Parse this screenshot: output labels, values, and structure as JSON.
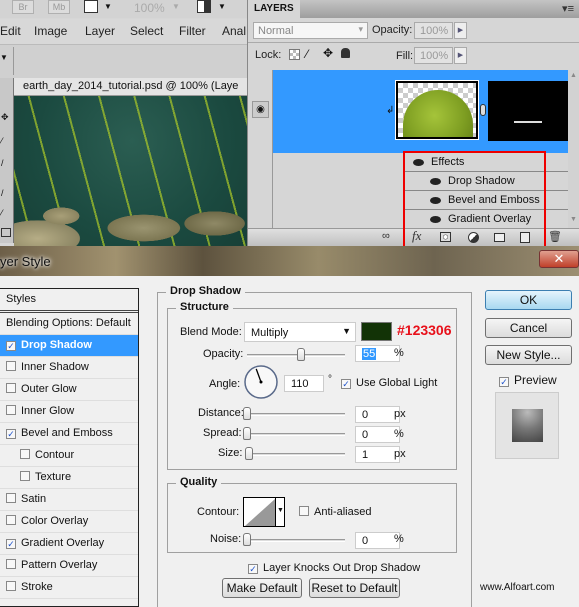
{
  "app": {
    "top_buttons": [
      "Br",
      "Mb"
    ],
    "zoom_display": "100%",
    "menu": [
      "Edit",
      "Image",
      "Layer",
      "Select",
      "Filter",
      "Anal"
    ]
  },
  "document": {
    "tab_title": "earth_day_2014_tutorial.psd @ 100% (Laye"
  },
  "layers_panel": {
    "tab_label": "LAYERS",
    "blend_mode": "Normal",
    "opacity_label": "Opacity:",
    "opacity_value": "100%",
    "lock_label": "Lock:",
    "fill_label": "Fill:",
    "fill_value": "100%",
    "effects_label": "Effects",
    "effects": [
      "Drop Shadow",
      "Bevel and Emboss",
      "Gradient Overlay"
    ],
    "footer_icons": [
      "link-layers-icon",
      "fx-icon",
      "add-mask-icon",
      "adjustment-layer-icon",
      "new-group-icon",
      "new-layer-icon",
      "delete-icon"
    ],
    "fx_label": "fx"
  },
  "dialog": {
    "title": "Layer Style",
    "title_visible": "yer Style",
    "close_glyph": "✕",
    "styles_header": "Styles",
    "blending_options": "Blending Options: Default",
    "style_items": [
      {
        "label": "Drop Shadow",
        "checked": true,
        "active": true,
        "sub": false
      },
      {
        "label": "Inner Shadow",
        "checked": false,
        "active": false,
        "sub": false
      },
      {
        "label": "Outer Glow",
        "checked": false,
        "active": false,
        "sub": false
      },
      {
        "label": "Inner Glow",
        "checked": false,
        "active": false,
        "sub": false
      },
      {
        "label": "Bevel and Emboss",
        "checked": true,
        "active": false,
        "sub": false
      },
      {
        "label": "Contour",
        "checked": false,
        "active": false,
        "sub": true
      },
      {
        "label": "Texture",
        "checked": false,
        "active": false,
        "sub": true
      },
      {
        "label": "Satin",
        "checked": false,
        "active": false,
        "sub": false
      },
      {
        "label": "Color Overlay",
        "checked": false,
        "active": false,
        "sub": false
      },
      {
        "label": "Gradient Overlay",
        "checked": true,
        "active": false,
        "sub": false
      },
      {
        "label": "Pattern Overlay",
        "checked": false,
        "active": false,
        "sub": false
      },
      {
        "label": "Stroke",
        "checked": false,
        "active": false,
        "sub": false
      }
    ],
    "section_title": "Drop Shadow",
    "structure": {
      "title": "Structure",
      "blend_mode_label": "Blend Mode:",
      "blend_mode_value": "Multiply",
      "shadow_color": "#123306",
      "color_annotation": "#123306",
      "opacity_label": "Opacity:",
      "opacity_value": "55",
      "opacity_unit": "%",
      "opacity_fraction": 0.55,
      "angle_label": "Angle:",
      "angle_value": "110",
      "angle_unit": "°",
      "use_global_light_label": "Use Global Light",
      "use_global_light": true,
      "distance_label": "Distance:",
      "distance_value": "0",
      "distance_unit": "px",
      "spread_label": "Spread:",
      "spread_value": "0",
      "spread_unit": "%",
      "size_label": "Size:",
      "size_value": "1",
      "size_unit": "px"
    },
    "quality": {
      "title": "Quality",
      "contour_label": "Contour:",
      "anti_aliased_label": "Anti-aliased",
      "anti_aliased": false,
      "noise_label": "Noise:",
      "noise_value": "0",
      "noise_unit": "%"
    },
    "knockout_label": "Layer Knocks Out Drop Shadow",
    "knockout_checked": true,
    "make_default": "Make Default",
    "reset_default": "Reset to Default",
    "ok": "OK",
    "cancel": "Cancel",
    "new_style": "New Style...",
    "preview_label": "Preview",
    "preview_checked": true
  },
  "watermark": "www.Alfoart.com"
}
